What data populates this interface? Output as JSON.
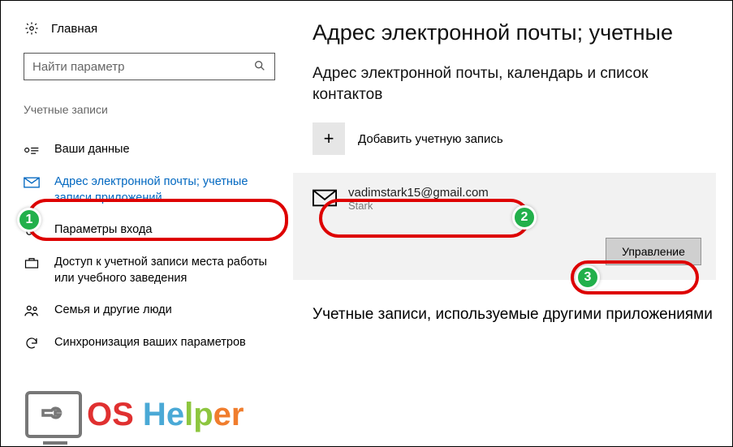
{
  "sidebar": {
    "home": "Главная",
    "search_placeholder": "Найти параметр",
    "section": "Учетные записи",
    "items": [
      {
        "label": "Ваши данные"
      },
      {
        "label": "Адрес электронной почты; учетные записи приложений"
      },
      {
        "label": "Параметры входа"
      },
      {
        "label": "Доступ к учетной записи места работы или учебного заведения"
      },
      {
        "label": "Семья и другие люди"
      },
      {
        "label": "Синхронизация ваших параметров"
      }
    ]
  },
  "main": {
    "title": "Адрес электронной почты; учетные",
    "subtitle": "Адрес электронной почты, календарь и список контактов",
    "add_label": "Добавить учетную запись",
    "account": {
      "email": "vadimstark15@gmail.com",
      "alias": "Stark"
    },
    "manage": "Управление",
    "lower_title": "Учетные записи, используемые другими приложениями"
  },
  "annotations": {
    "b1": "1",
    "b2": "2",
    "b3": "3"
  },
  "watermark": {
    "os": "OS",
    "h": "H",
    "e": "e",
    "l": "l",
    "p": "p",
    "er": "er"
  }
}
